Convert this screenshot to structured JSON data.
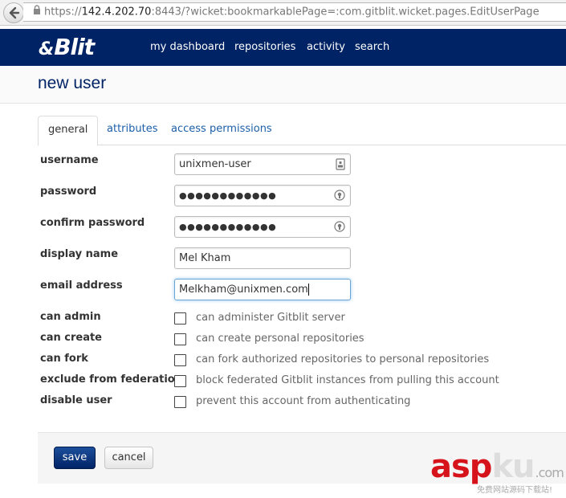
{
  "browser": {
    "url_scheme": "https://",
    "url_host": "142.4.202.70",
    "url_rest": ":8443/?wicket:bookmarkablePage=:com.gitblit.wicket.pages.EditUserPage"
  },
  "navbar": {
    "logo": "Blit",
    "items": [
      "my dashboard",
      "repositories",
      "activity",
      "search"
    ]
  },
  "page": {
    "title": "new user"
  },
  "tabs": [
    {
      "label": "general",
      "active": true
    },
    {
      "label": "attributes",
      "active": false
    },
    {
      "label": "access permissions",
      "active": false
    }
  ],
  "form": {
    "username": {
      "label": "username",
      "value": "unixmen-user"
    },
    "password": {
      "label": "password",
      "value": "●●●●●●●●●●●●"
    },
    "confirm_password": {
      "label": "confirm password",
      "value": "●●●●●●●●●●●●"
    },
    "display_name": {
      "label": "display name",
      "value": "Mel Kham"
    },
    "email": {
      "label": "email address",
      "value": "Melkham@unixmen.com"
    },
    "checkboxes": [
      {
        "label": "can admin",
        "description": "can administer Gitblit server",
        "checked": false
      },
      {
        "label": "can create",
        "description": "can create personal repositories",
        "checked": false
      },
      {
        "label": "can fork",
        "description": "can fork authorized repositories to personal repositories",
        "checked": false
      },
      {
        "label": "exclude from federation",
        "description": "block federated Gitblit instances from pulling this account",
        "checked": false
      },
      {
        "label": "disable user",
        "description": "prevent this account from authenticating",
        "checked": false
      }
    ]
  },
  "actions": {
    "save": "save",
    "cancel": "cancel"
  },
  "watermark": {
    "brand_a": "asp",
    "brand_b": "ku",
    "brand_c": ".com",
    "sub": "免费网站源码下载站!"
  },
  "colors": {
    "navbar": "#002365",
    "link": "#1c5fa8",
    "save_button": "#002365"
  }
}
